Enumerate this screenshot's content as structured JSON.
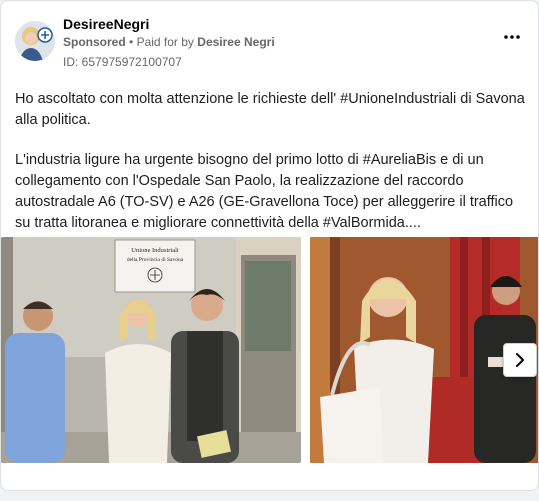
{
  "post": {
    "author": "DesireeNegri",
    "sponsored_label": "Sponsored",
    "separator": "•",
    "paid_for_prefix": "Paid for by",
    "paid_for_by": "Desiree Negri",
    "ad_id": "ID: 657975972100707",
    "paragraph_1": "Ho ascoltato con molta attenzione le richieste dell' #UnioneIndustriali di Savona alla politica.",
    "paragraph_2": "L'industria ligure ha urgente bisogno del primo lotto di #AureliaBis e di un collegamento con l'Ospedale San Paolo, la realizzazione del raccordo autostradale A6 (TO-SV) e A26 (GE-Gravellona Toce) per alleggerire il traffico su tratta litoranea e migliorare connettività della #ValBormida...."
  },
  "carousel": {
    "slides": [
      {
        "plaque_line_1": "Unione Industriali",
        "plaque_line_2": "della Provincia di Savona"
      },
      {}
    ]
  },
  "icons": {
    "more": "more-horizontal-icon",
    "next": "chevron-right-icon",
    "logo": "unione-industriali-logo-icon"
  },
  "colors": {
    "background": "#f0f2f5",
    "card": "#ffffff",
    "secondary_text": "#65676b"
  }
}
